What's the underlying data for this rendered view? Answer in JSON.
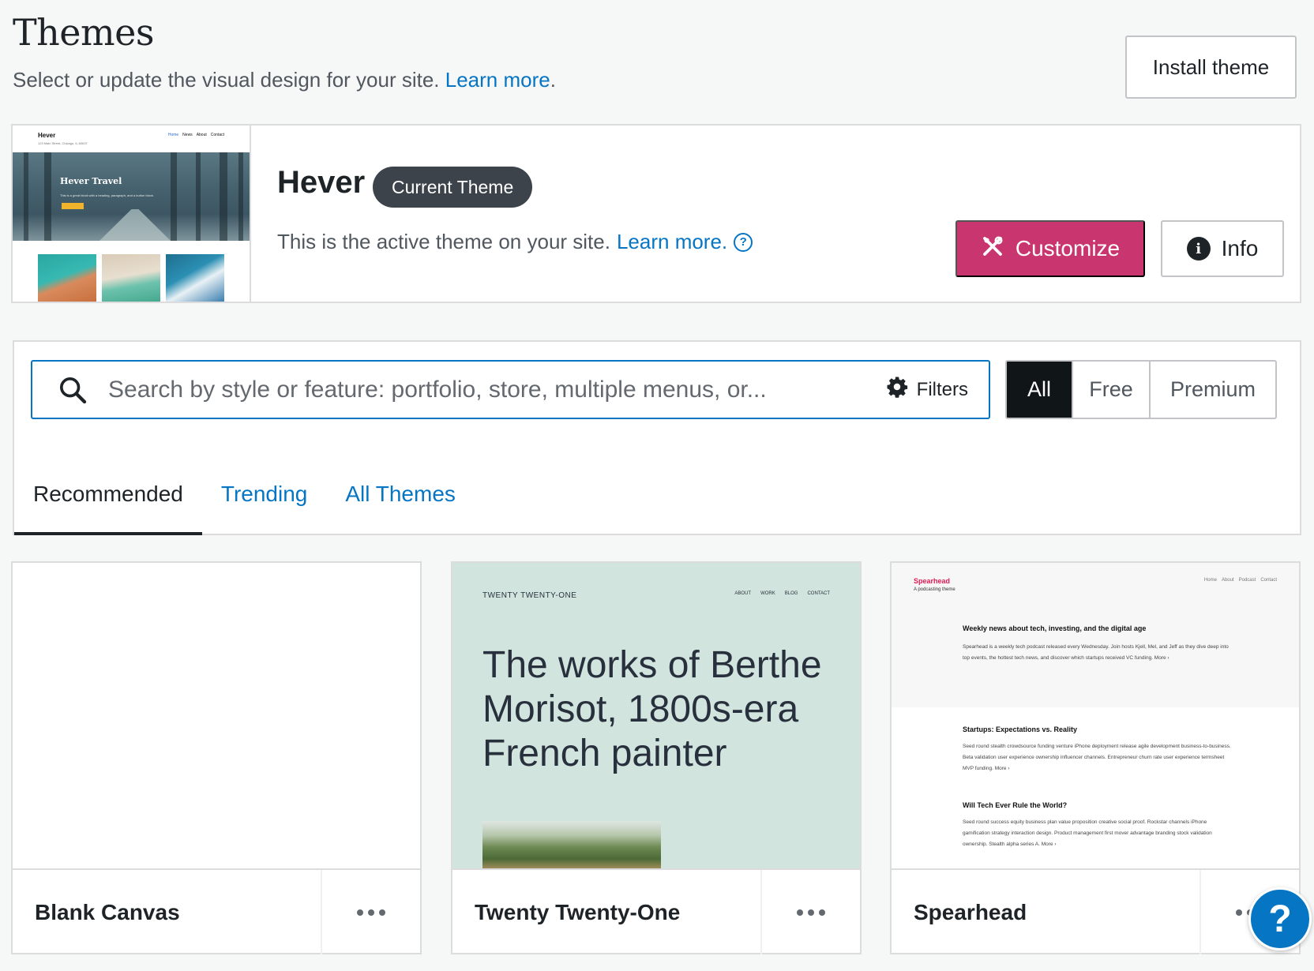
{
  "header": {
    "title": "Themes",
    "subtitle": "Select or update the visual design for your site.",
    "learn_more": "Learn more",
    "install_button": "Install theme"
  },
  "current_theme": {
    "name": "Hever",
    "badge": "Current Theme",
    "description": "This is the active theme on your site.",
    "learn_more": "Learn more.",
    "customize_button": "Customize",
    "info_button": "Info",
    "preview": {
      "site_name": "Hever",
      "tagline": "123 Main Street, Chicago, IL 60637",
      "nav": [
        "Home",
        "News",
        "About",
        "Contact"
      ],
      "hero_title": "Hever Travel",
      "hero_text": "This is a great block with a heading, paragraph, and a button block.",
      "hero_button": "Get Away"
    }
  },
  "search": {
    "placeholder": "Search by style or feature: portfolio, store, multiple menus, or...",
    "filters_label": "Filters",
    "tiers": [
      "All",
      "Free",
      "Premium"
    ],
    "active_tier": "All"
  },
  "tabs": [
    {
      "label": "Recommended",
      "active": true
    },
    {
      "label": "Trending",
      "active": false
    },
    {
      "label": "All Themes",
      "active": false
    }
  ],
  "themes": [
    {
      "name": "Blank Canvas"
    },
    {
      "name": "Twenty Twenty-One",
      "preview": {
        "brand": "TWENTY TWENTY-ONE",
        "nav": [
          "ABOUT",
          "WORK",
          "BLOG",
          "CONTACT"
        ],
        "headline": "The works of Berthe Morisot, 1800s-era French painter"
      }
    },
    {
      "name": "Spearhead",
      "preview": {
        "brand": "Spearhead",
        "tagline": "A podcasting theme",
        "nav": [
          "Home",
          "About",
          "Podcast",
          "Contact"
        ],
        "posts": [
          {
            "title": "Weekly news about tech, investing, and the digital age",
            "body": "Spearhead is a weekly tech podcast released every Wednesday. Join hosts Kjell, Mel, and Jeff as they dive deep into top events, the hottest tech news, and discover which startups received VC funding.  More ›"
          },
          {
            "title": "Startups: Expectations vs. Reality",
            "body": "Seed round stealth crowdsource funding venture iPhone deployment release agile development business-to-business. Beta validation user experience ownership influencer channels. Entrepreneur churn rate user experience termsheet MVP funding.  More ›"
          },
          {
            "title": "Will Tech Ever Rule the World?",
            "body": "Seed round success equity business plan value proposition creative social proof. Rockstar channels iPhone gamification strategy interaction design. Product management first mover advantage branding stock validation ownership. Stealth alpha series A.  More ›"
          }
        ]
      }
    }
  ],
  "help_fab": "?",
  "colors": {
    "accent": "#0675c4",
    "customize": "#c9356e",
    "badge": "#3c434a",
    "tier_active": "#101517"
  }
}
